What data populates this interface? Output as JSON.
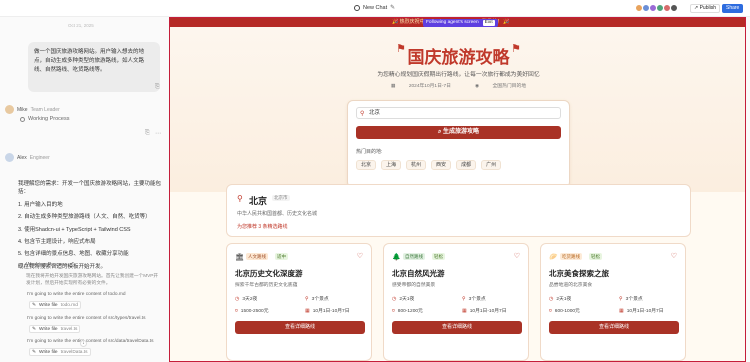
{
  "topbar": {
    "title": "New Chat",
    "publish": "Publish",
    "share": "Share"
  },
  "left": {
    "timestamp": "Oct 21, 2025",
    "user_message": "做一个国庆旅游攻略网站。用户输入想去的地点，自动生成多种类型的旅游路线，如人文路线、自然路线、吃货路线等。",
    "mike": {
      "name": "Mike",
      "role": "Team Leader",
      "status": "Working Process"
    },
    "alex": {
      "name": "Alex",
      "role": "Engineer",
      "status": "Working Process",
      "intro": "我理解您的需求：开发一个国庆旅游攻略网站，主要功能包括：",
      "points": [
        "1. 用户输入目的地",
        "2. 自动生成多种类型旅游路线（人文、自然、吃货等）",
        "3. 使用Shadcn-ui + TypeScript + Tailwind CSS",
        "4. 包含节主题设计，响应式布局",
        "5. 包含详细的景点信息、地图、收藏分享功能",
        "现在我将搜索合适的模板开始开发。"
      ],
      "thought": "现在我将开始开发国庆旅游攻略网站。首先让我创建一个MVP开发计划，然后开始实现所有必要的文件。",
      "writes": [
        {
          "text": "I'm going to write the entire content of todo.md",
          "label": "Write file",
          "file": "todo.md"
        },
        {
          "text": "I'm going to write the entire content of src/types/travel.ts",
          "label": "Write file",
          "file": "travel.ts"
        },
        {
          "text": "I'm going to write the entire content of src/data/travelData.ts",
          "label": "Write file",
          "file": "travelData.ts"
        }
      ]
    }
  },
  "preview": {
    "banner_left": "🎉 热烈庆祝中",
    "follow": "Following agent's screen",
    "exit": "Exit",
    "banner_right": "聚最美！ 🎉",
    "title": "国庆旅游攻略",
    "subtitle": "为您精心规划国庆假期出行路线，让每一次旅行都成为美好回忆",
    "date": "2024年10月1日-7日",
    "scope": "全国热门目的地",
    "search_value": "北京",
    "search_button": "生成旅游攻略",
    "hot_label": "热门目的地:",
    "hot": [
      "北京",
      "上海",
      "杭州",
      "西安",
      "成都",
      "广州"
    ],
    "city": {
      "name": "北京",
      "tag": "北京市",
      "desc": "中华人民共和国首都、历史文化名城",
      "count": "为您推荐 3 条精选路线"
    },
    "cards": [
      {
        "icon": "🏛",
        "badge": "人文路线",
        "level": "适中",
        "title": "北京历史文化深度游",
        "desc": "探索千年古都的历史文化底蕴",
        "days": "3天2夜",
        "spots": "3个景点",
        "price": "1500-2500元",
        "date": "10月1日-10月7日",
        "button": "查看详细路线"
      },
      {
        "icon": "🌲",
        "badge": "自然路线",
        "level": "轻松",
        "title": "北京自然风光游",
        "desc": "感受帝都的自然美景",
        "days": "2天1夜",
        "spots": "3个景点",
        "price": "800-1200元",
        "date": "10月1日-10月7日",
        "button": "查看详细路线"
      },
      {
        "icon": "🥟",
        "badge": "吃货路线",
        "level": "轻松",
        "title": "北京美食探索之旅",
        "desc": "品尝地道的北京美食",
        "days": "2天1夜",
        "spots": "3个景点",
        "price": "600-1000元",
        "date": "10月1日-10月7日",
        "button": "查看详细路线"
      }
    ]
  },
  "colors": {
    "brand_red": "#c0392b",
    "button_red": "#a93226",
    "share_blue": "#2d6cdf",
    "follow_purple": "#5e3fe0"
  }
}
